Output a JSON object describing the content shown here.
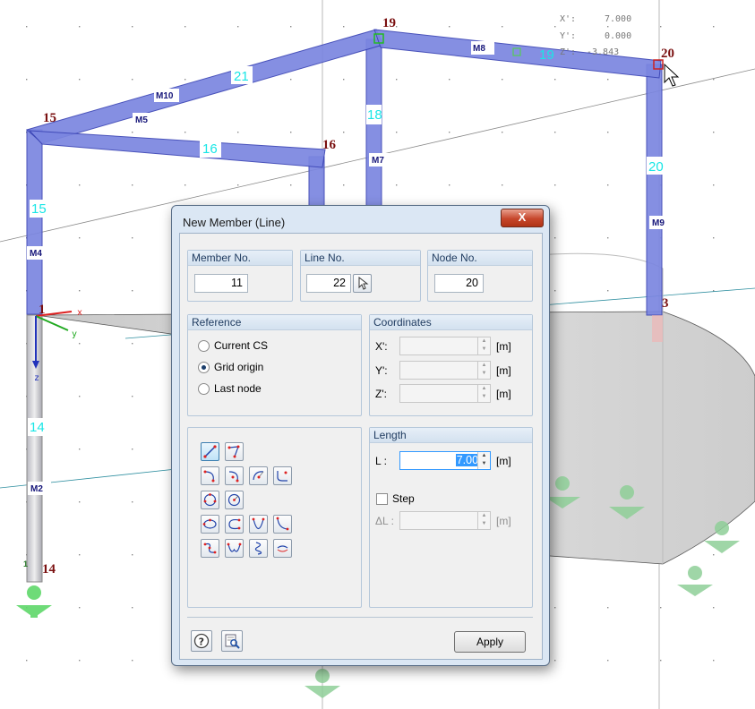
{
  "viewport": {
    "coord_readout": {
      "x_label": "X':",
      "x_value": "7.000",
      "y_label": "Y':",
      "y_value": "0.000",
      "z_label": "Z':",
      "z_value": "-3.843"
    },
    "nodes": [
      "19",
      "20",
      "15",
      "16",
      "1",
      "3",
      "14"
    ],
    "lines": [
      "21",
      "19",
      "18",
      "16",
      "15",
      "20",
      "14"
    ],
    "members": [
      "M10",
      "M8",
      "M5",
      "M7",
      "M4",
      "M9",
      "M2"
    ],
    "axis_labels": {
      "x": "x",
      "y": "y",
      "z": "z"
    },
    "support_small_number": "1"
  },
  "dialog": {
    "title": "New Member (Line)",
    "close_label": "X",
    "member_no": {
      "label": "Member No.",
      "value": "11"
    },
    "line_no": {
      "label": "Line No.",
      "value": "22"
    },
    "node_no": {
      "label": "Node No.",
      "value": "20"
    },
    "reference": {
      "title": "Reference",
      "options": [
        "Current CS",
        "Grid origin",
        "Last node"
      ],
      "selected": "Grid origin"
    },
    "coordinates": {
      "title": "Coordinates",
      "rows": [
        {
          "label": "X':",
          "unit": "[m]"
        },
        {
          "label": "Y':",
          "unit": "[m]"
        },
        {
          "label": "Z':",
          "unit": "[m]"
        }
      ]
    },
    "length": {
      "title": "Length",
      "label": "L :",
      "value": "7.000",
      "unit": "[m]",
      "step_label": "Step",
      "step_checked": false,
      "delta_label": "ΔL :",
      "delta_unit": "[m]"
    },
    "apply_label": "Apply",
    "colors": {
      "accent": "#3399ff",
      "member_fill": "#7b86e0",
      "node_text": "#7a1010",
      "line_number": "#19e6e6"
    }
  }
}
